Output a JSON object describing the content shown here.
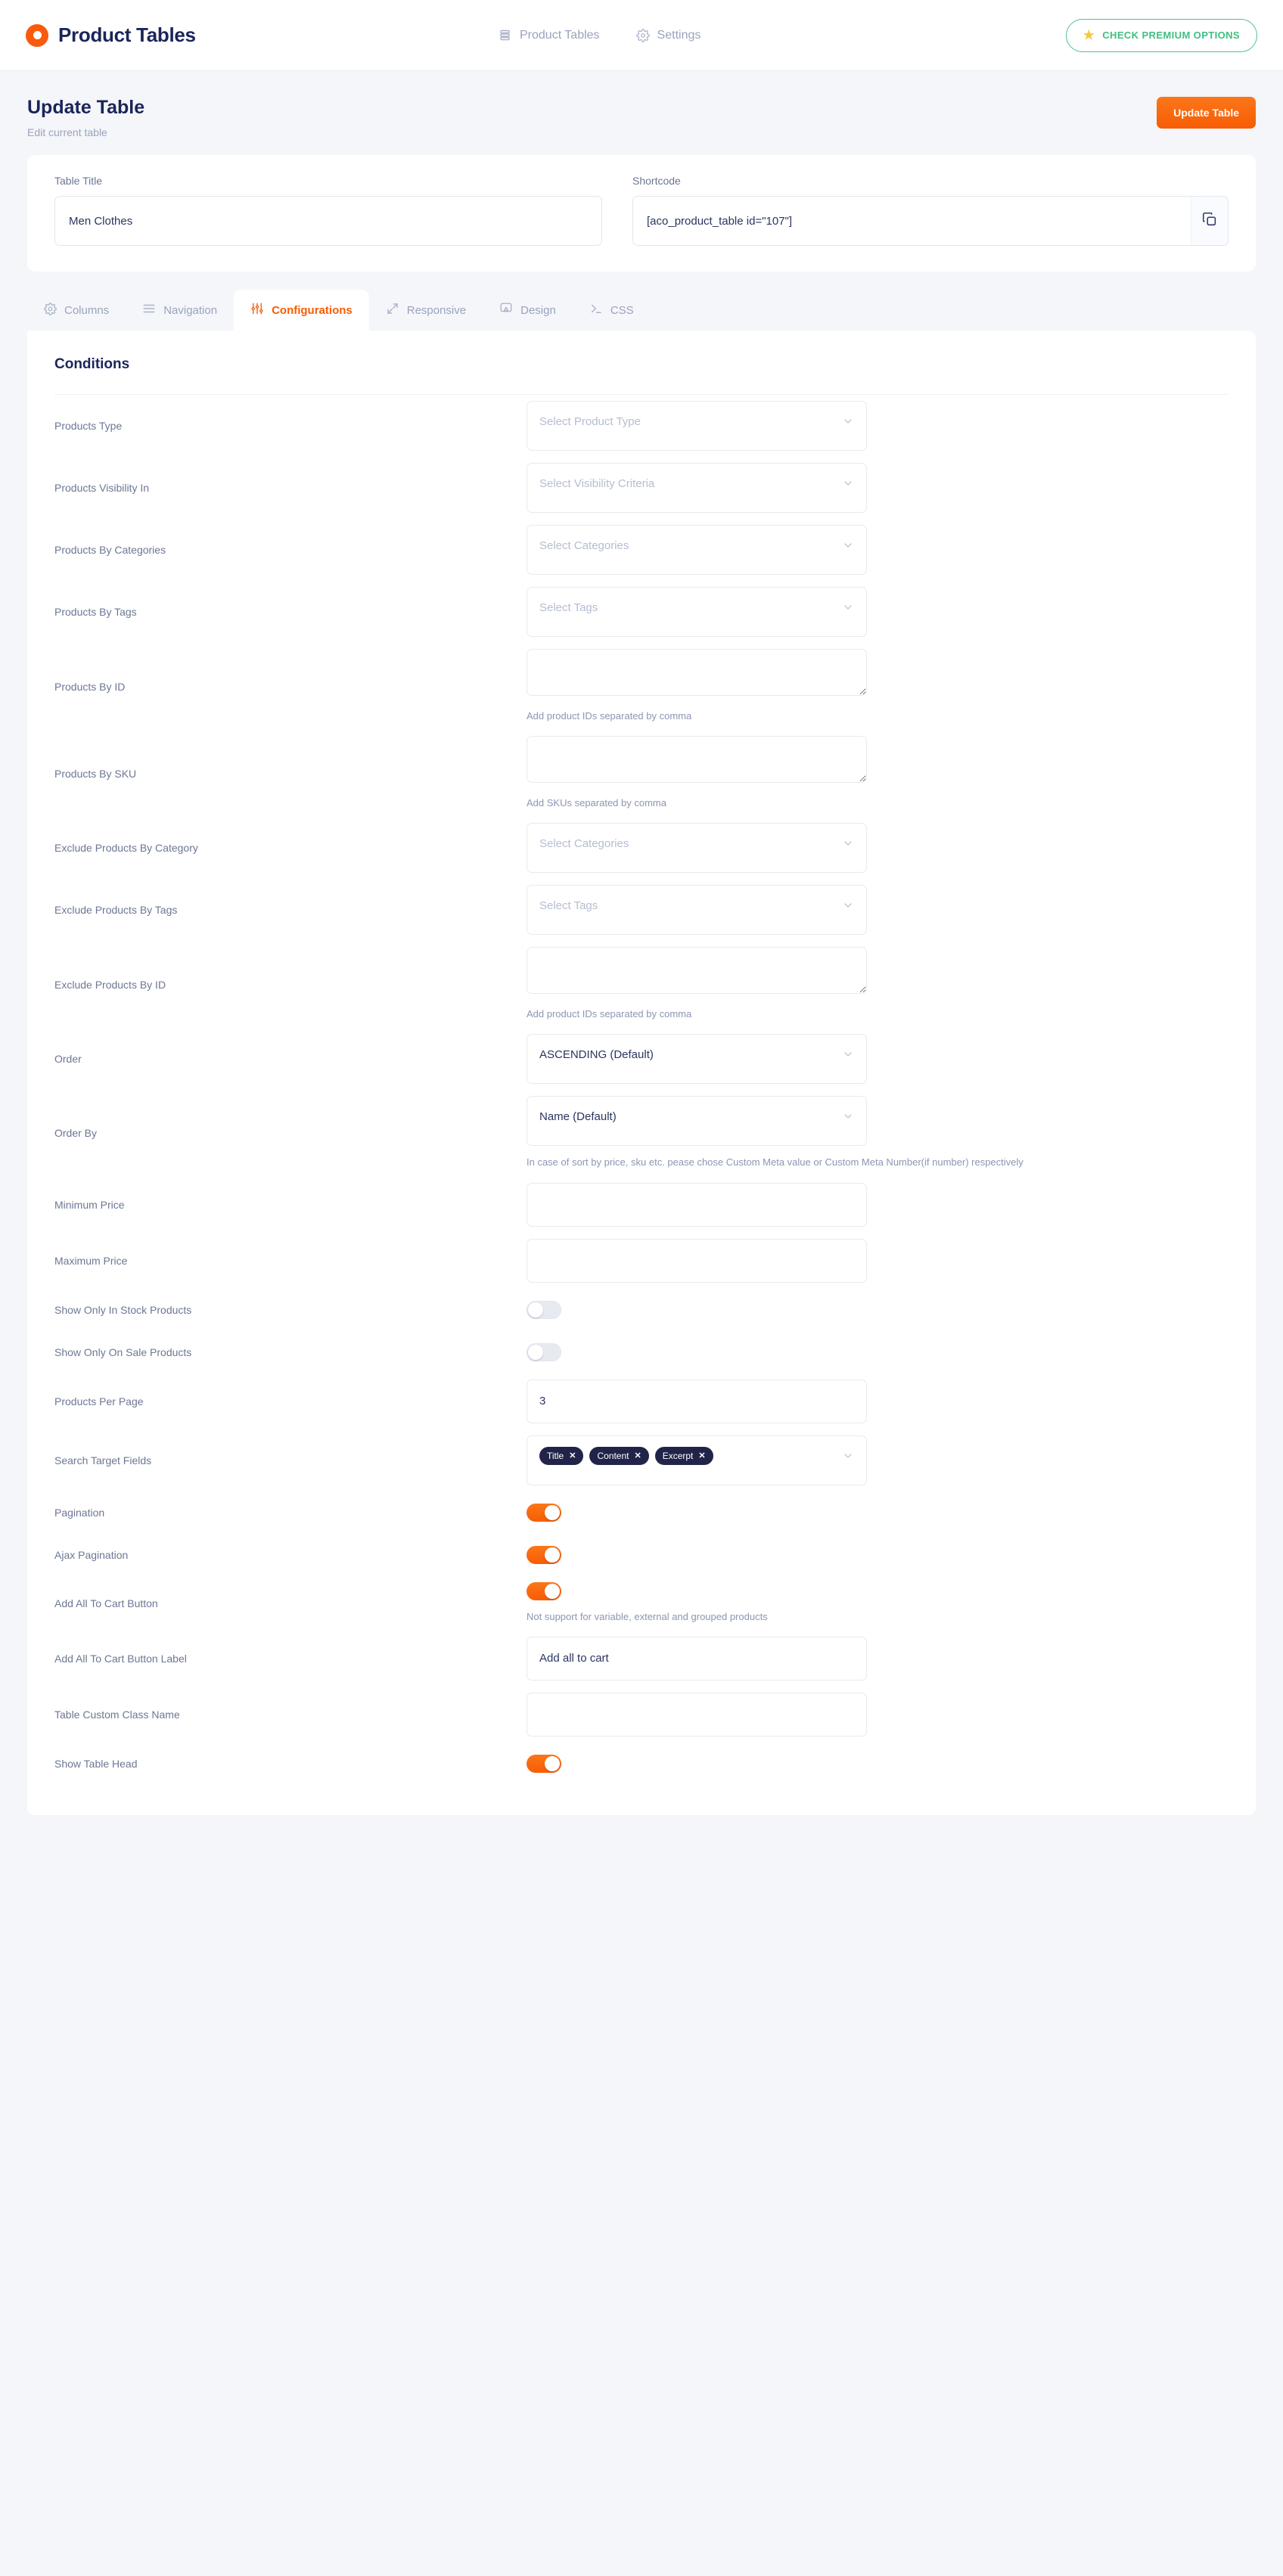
{
  "topbar": {
    "brand": "Product Tables",
    "nav": [
      {
        "label": "Product Tables",
        "icon": "list-icon"
      },
      {
        "label": "Settings",
        "icon": "gear-icon"
      }
    ],
    "premium_label": "CHECK PREMIUM OPTIONS",
    "star_glyph": "★"
  },
  "pagehead": {
    "title": "Update Table",
    "subtitle": "Edit current table",
    "update_button": "Update Table"
  },
  "meta": {
    "table_title_label": "Table Title",
    "table_title_value": "Men Clothes",
    "shortcode_label": "Shortcode",
    "shortcode_value": "[aco_product_table id=\"107\"]",
    "copy_icon": "copy-icon"
  },
  "tabs": [
    {
      "label": "Columns",
      "icon": "gear-icon",
      "active": false
    },
    {
      "label": "Navigation",
      "icon": "menu-icon",
      "active": false
    },
    {
      "label": "Configurations",
      "icon": "sliders-icon",
      "active": true
    },
    {
      "label": "Responsive",
      "icon": "resize-icon",
      "active": false
    },
    {
      "label": "Design",
      "icon": "monitor-icon",
      "active": false
    },
    {
      "label": "CSS",
      "icon": "terminal-icon",
      "active": false
    }
  ],
  "panel": {
    "title": "Conditions",
    "rows": [
      {
        "label": "Products Type",
        "type": "select",
        "value": "Select Product Type",
        "filled": false
      },
      {
        "label": "Products Visibility In",
        "type": "select",
        "value": "Select Visibility Criteria",
        "filled": false
      },
      {
        "label": "Products By Categories",
        "type": "select",
        "value": "Select Categories",
        "filled": false
      },
      {
        "label": "Products By Tags",
        "type": "select",
        "value": "Select Tags",
        "filled": false
      },
      {
        "label": "Products By ID",
        "type": "textarea",
        "value": "",
        "hint": "Add product IDs separated by comma"
      },
      {
        "label": "Products By SKU",
        "type": "textarea",
        "value": "",
        "hint": "Add SKUs separated by comma"
      },
      {
        "label": "Exclude Products By Category",
        "type": "select",
        "value": "Select Categories",
        "filled": false
      },
      {
        "label": "Exclude Products By Tags",
        "type": "select",
        "value": "Select Tags",
        "filled": false
      },
      {
        "label": "Exclude Products By ID",
        "type": "textarea",
        "value": "",
        "hint": "Add product IDs separated by comma"
      },
      {
        "label": "Order",
        "type": "select",
        "value": "ASCENDING (Default)",
        "filled": true
      },
      {
        "label": "Order By",
        "type": "select",
        "value": "Name (Default)",
        "filled": true,
        "hint": "In case of sort by price, sku etc. pease chose Custom Meta value or Custom Meta Number(if number) respectively"
      },
      {
        "label": "Minimum Price",
        "type": "input",
        "value": ""
      },
      {
        "label": "Maximum Price",
        "type": "input",
        "value": ""
      },
      {
        "label": "Show Only In Stock Products",
        "type": "toggle",
        "on": false
      },
      {
        "label": "Show Only On Sale Products",
        "type": "toggle",
        "on": false
      },
      {
        "label": "Products Per Page",
        "type": "input",
        "value": "3"
      },
      {
        "label": "Search Target Fields",
        "type": "chips",
        "chips": [
          "Title",
          "Content",
          "Excerpt"
        ],
        "chip_remove": "✕"
      },
      {
        "label": "Pagination",
        "type": "toggle",
        "on": true
      },
      {
        "label": "Ajax Pagination",
        "type": "toggle",
        "on": true
      },
      {
        "label": "Add All To Cart Button",
        "type": "toggle",
        "on": true,
        "hint": "Not support for variable, external and grouped products"
      },
      {
        "label": "Add All To Cart Button Label",
        "type": "input",
        "value": "Add all to cart"
      },
      {
        "label": "Table Custom Class Name",
        "type": "input",
        "value": ""
      },
      {
        "label": "Show Table Head",
        "type": "toggle",
        "on": true
      }
    ]
  },
  "colors": {
    "accent": "#f75c05",
    "navy": "#1b2559",
    "chip_bg": "#212448",
    "green": "#3fbf82",
    "star": "#f6c744",
    "page_bg": "#f4f6fa"
  }
}
